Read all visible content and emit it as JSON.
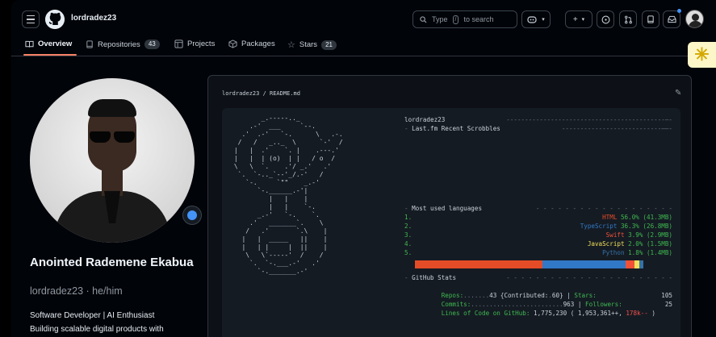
{
  "header": {
    "username": "lordradez23",
    "search_prefix": "Type",
    "search_key": "/",
    "search_suffix": "to search"
  },
  "tabs": [
    {
      "label": "Overview",
      "count": null
    },
    {
      "label": "Repositories",
      "count": "43"
    },
    {
      "label": "Projects",
      "count": null
    },
    {
      "label": "Packages",
      "count": null
    },
    {
      "label": "Stars",
      "count": "21"
    }
  ],
  "profile": {
    "full_name": "Anointed Rademene Ekabua",
    "login": "lordradez23",
    "pronouns": "he/him",
    "bio_line1": "Software Developer | AI Enthusiast",
    "bio_line2": "Building scalable digital products with"
  },
  "readme": {
    "path": "lordradez23 / README.md",
    "title": "lordradez23",
    "section_scrobbles": "Last.fm Recent Scrobbles",
    "section_languages": "Most used languages",
    "languages": [
      {
        "num": "1.",
        "name": "HTML",
        "pct": "56.0%",
        "size": "(41.3MB)",
        "color": "#e34c26"
      },
      {
        "num": "2.",
        "name": "TypeScript",
        "pct": "36.3%",
        "size": "(26.8MB)",
        "color": "#3178c6"
      },
      {
        "num": "3.",
        "name": "Swift",
        "pct": "3.9%",
        "size": "(2.9MB)",
        "color": "#f05138"
      },
      {
        "num": "4.",
        "name": "JavaScript",
        "pct": "2.0%",
        "size": "(1.5MB)",
        "color": "#f1e05a"
      },
      {
        "num": "5.",
        "name": "Python",
        "pct": "1.8%",
        "size": "(1.4MB)",
        "color": "#3572a5"
      }
    ],
    "section_stats": "GitHub Stats",
    "stats": {
      "repos_label": "Repos:",
      "repos": "43",
      "contributed_label": "{Contributed:",
      "contributed": "60}",
      "stars_label": "Stars:",
      "stars": "105",
      "commits_label": "Commits:",
      "commits": "963",
      "followers_label": "Followers:",
      "followers": "25",
      "loc_label": "Lines of Code on GitHub:",
      "loc": "1,775,230",
      "loc_added": "( 1,953,361++,",
      "loc_removed": "178k--",
      "loc_close": ")"
    }
  },
  "colors": {
    "accent_tab": "#f78166",
    "green": "#3fb950",
    "red": "#f85149",
    "status_blue": "#4493f8"
  },
  "icons": [
    "hamburger-icon",
    "github-logo-icon",
    "search-icon",
    "copilot-icon",
    "plus-icon",
    "issues-icon",
    "pull-requests-icon",
    "inbox-icon",
    "pencil-icon"
  ]
}
